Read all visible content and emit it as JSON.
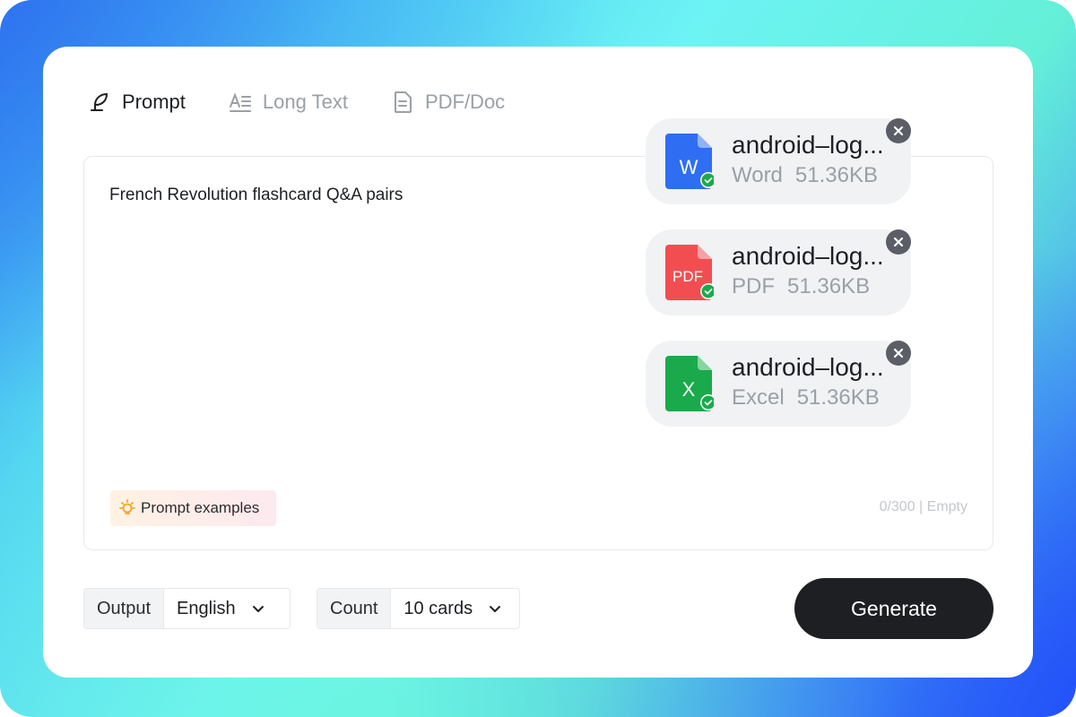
{
  "tabs": [
    {
      "label": "Prompt",
      "icon": "feather-icon",
      "active": true
    },
    {
      "label": "Long Text",
      "icon": "text-format-icon",
      "active": false
    },
    {
      "label": "PDF/Doc",
      "icon": "document-icon",
      "active": false
    }
  ],
  "editor": {
    "text": "French Revolution flashcard Q&A pairs",
    "examples_label": "Prompt examples",
    "counter": "0/300 | Empty"
  },
  "files": [
    {
      "name": "android–log...",
      "type": "Word",
      "size": "51.36KB",
      "badge": "W",
      "color": "#2f6ef3"
    },
    {
      "name": "android–log...",
      "type": "PDF",
      "size": "51.36KB",
      "badge": "PDF",
      "color": "#f24e52"
    },
    {
      "name": "android–log...",
      "type": "Excel",
      "size": "51.36KB",
      "badge": "X",
      "color": "#1aaa4b"
    }
  ],
  "output": {
    "label": "Output",
    "value": "English"
  },
  "count": {
    "label": "Count",
    "value": "10 cards"
  },
  "generate_label": "Generate"
}
